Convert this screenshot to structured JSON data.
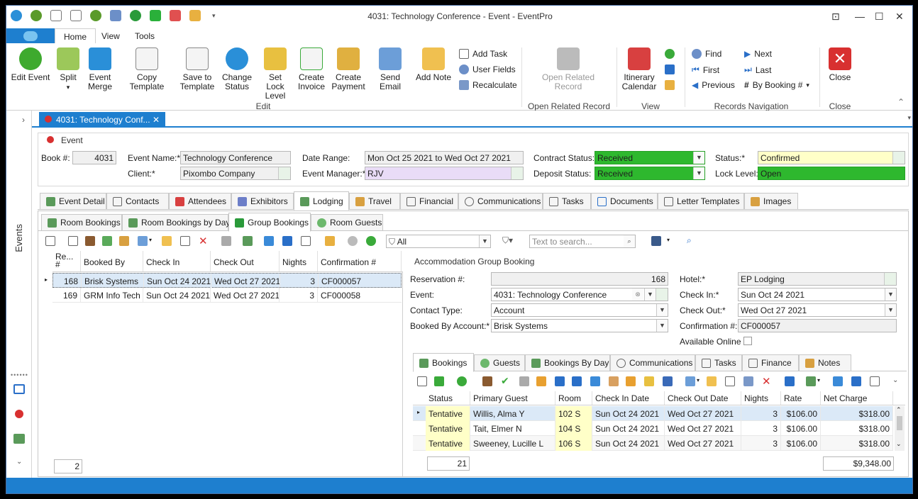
{
  "window": {
    "title": "4031: Technology Conference - Event - EventPro",
    "min": "—",
    "max": "☐",
    "close": "✕",
    "pin": "⊡"
  },
  "ribbon": {
    "tabs": [
      "Home",
      "View",
      "Tools"
    ],
    "buttons": {
      "edit_event": "Edit Event",
      "split": "Split",
      "event_merge_1": "Event",
      "event_merge_2": "Merge",
      "copy_template": "Copy Template",
      "save_template_1": "Save to",
      "save_template_2": "Template",
      "change_status_1": "Change",
      "change_status_2": "Status",
      "set_lock_1": "Set Lock",
      "set_lock_2": "Level",
      "create_invoice_1": "Create",
      "create_invoice_2": "Invoice",
      "create_payment_1": "Create",
      "create_payment_2": "Payment",
      "send_email": "Send Email",
      "add_note": "Add Note",
      "add_task": "Add Task",
      "user_fields": "User Fields",
      "recalculate": "Recalculate",
      "open_related_1": "Open Related",
      "open_related_2": "Record",
      "itinerary_1": "Itinerary",
      "itinerary_2": "Calendar",
      "find": "Find",
      "first": "First",
      "previous": "Previous",
      "next": "Next",
      "last": "Last",
      "by_booking": "By Booking #",
      "close": "Close"
    },
    "groups": {
      "edit": "Edit",
      "open_related": "Open Related Record",
      "view": "View",
      "records_nav": "Records Navigation",
      "close": "Close"
    }
  },
  "leftnav": {
    "label": "Events"
  },
  "doctab": {
    "label": "4031: Technology Conf...",
    "close": "✕"
  },
  "event": {
    "section": "Event",
    "book_label": "Book #:",
    "book": "4031",
    "event_name_label": "Event Name:*",
    "event_name": "Technology Conference",
    "client_label": "Client:*",
    "client": "Pixombo Company",
    "date_range_label": "Date Range:",
    "date_range": "Mon Oct 25 2021 to Wed Oct 27 2021",
    "event_manager_label": "Event Manager:*",
    "event_manager": "RJV",
    "contract_status_label": "Contract Status:",
    "contract_status": "Received",
    "deposit_status_label": "Deposit Status:",
    "deposit_status": "Received",
    "status_label": "Status:*",
    "status": "Confirmed",
    "lock_level_label": "Lock Level:",
    "lock_level": "Open"
  },
  "main_tabs": [
    "Event Detail",
    "Contacts",
    "Attendees",
    "Exhibitors",
    "Lodging",
    "Travel",
    "Financial",
    "Communications",
    "Tasks",
    "Documents",
    "Letter Templates",
    "Images"
  ],
  "lodging_tabs": [
    "Room Bookings",
    "Room Bookings by Day",
    "Group Bookings",
    "Room Guests"
  ],
  "filter": {
    "value": "All",
    "search_placeholder": "Text to search..."
  },
  "left_grid": {
    "headers": [
      "Re... #",
      "Booked By",
      "Check In",
      "Check Out",
      "Nights",
      "Confirmation #"
    ],
    "rows": [
      {
        "res": "168",
        "booked_by": "Brisk Systems",
        "check_in": "Sun Oct 24 2021",
        "check_out": "Wed Oct 27 2021",
        "nights": "3",
        "conf": "CF000057"
      },
      {
        "res": "169",
        "booked_by": "GRM Info Tech",
        "check_in": "Sun Oct 24 2021",
        "check_out": "Wed Oct 27 2021",
        "nights": "3",
        "conf": "CF000058"
      }
    ],
    "count": "2"
  },
  "agb": {
    "section": "Accommodation Group Booking",
    "reservation_label": "Reservation #:",
    "reservation": "168",
    "event_label": "Event:",
    "event": "4031: Technology Conference",
    "contact_type_label": "Contact Type:",
    "contact_type": "Account",
    "booked_by_label": "Booked By Account:*",
    "booked_by": "Brisk Systems",
    "hotel_label": "Hotel:*",
    "hotel": "EP Lodging",
    "check_in_label": "Check In:*",
    "check_in": "Sun Oct 24 2021",
    "check_out_label": "Check Out:*",
    "check_out": "Wed Oct 27 2021",
    "confirmation_label": "Confirmation #:",
    "confirmation": "CF000057",
    "available_online_label": "Available Online"
  },
  "sub_tabs": [
    "Bookings",
    "Guests",
    "Bookings By Day",
    "Communications",
    "Tasks",
    "Finance",
    "Notes"
  ],
  "bookings_grid": {
    "headers": [
      "Status",
      "Primary Guest",
      "Room",
      "Check In Date",
      "Check Out Date",
      "Nights",
      "Rate",
      "Net Charge"
    ],
    "rows": [
      {
        "status": "Tentative",
        "guest": "Willis, Alma Y",
        "room": "102 S",
        "in": "Sun Oct 24 2021",
        "out": "Wed Oct 27 2021",
        "nights": "3",
        "rate": "$106.00",
        "net": "$318.00"
      },
      {
        "status": "Tentative",
        "guest": "Tait, Elmer N",
        "room": "104 S",
        "in": "Sun Oct 24 2021",
        "out": "Wed Oct 27 2021",
        "nights": "3",
        "rate": "$106.00",
        "net": "$318.00"
      },
      {
        "status": "Tentative",
        "guest": "Sweeney, Lucille L",
        "room": "106 S",
        "in": "Sun Oct 24 2021",
        "out": "Wed Oct 27 2021",
        "nights": "3",
        "rate": "$106.00",
        "net": "$318.00"
      }
    ],
    "count": "21",
    "total": "$9,348.00"
  }
}
